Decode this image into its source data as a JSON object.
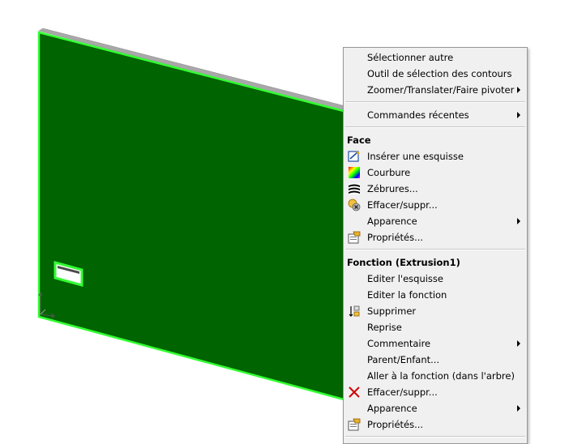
{
  "menu": {
    "items_top": [
      {
        "label": "Sélectionner autre",
        "submenu": false
      },
      {
        "label": "Outil de sélection des contours",
        "submenu": false
      },
      {
        "label": "Zoomer/Translater/Faire pivoter",
        "submenu": true
      }
    ],
    "recent": {
      "label": "Commandes récentes",
      "submenu": true
    },
    "face": {
      "header": "Face",
      "items": [
        {
          "label": "Insérer une esquisse",
          "icon": "sketch-icon"
        },
        {
          "label": "Courbure",
          "icon": "curvature-icon"
        },
        {
          "label": "Zébrures...",
          "icon": "zebra-stripes-icon"
        },
        {
          "label": "Effacer/suppr...",
          "icon": "delete-face-icon"
        },
        {
          "label": "Apparence",
          "icon": "",
          "submenu": true
        },
        {
          "label": "Propriétés...",
          "icon": "properties-icon"
        }
      ]
    },
    "feature": {
      "header": "Fonction (Extrusion1)",
      "items": [
        {
          "label": "Editer l'esquisse",
          "icon": ""
        },
        {
          "label": "Editer la fonction",
          "icon": ""
        },
        {
          "label": "Supprimer",
          "icon": "suppress-icon"
        },
        {
          "label": "Reprise",
          "icon": ""
        },
        {
          "label": "Commentaire",
          "icon": "",
          "submenu": true
        },
        {
          "label": "Parent/Enfant...",
          "icon": ""
        },
        {
          "label": "Aller à la fonction (dans l'arbre)",
          "icon": ""
        },
        {
          "label": "Effacer/suppr...",
          "icon": "delete-x-icon"
        },
        {
          "label": "Apparence",
          "icon": "",
          "submenu": true
        },
        {
          "label": "Propriétés...",
          "icon": "properties-icon"
        }
      ]
    }
  },
  "colors": {
    "face_fill": "#006400",
    "edge_highlight": "#33ff33",
    "top_edge": "#a8a8a8",
    "delete_red": "#d40000"
  }
}
